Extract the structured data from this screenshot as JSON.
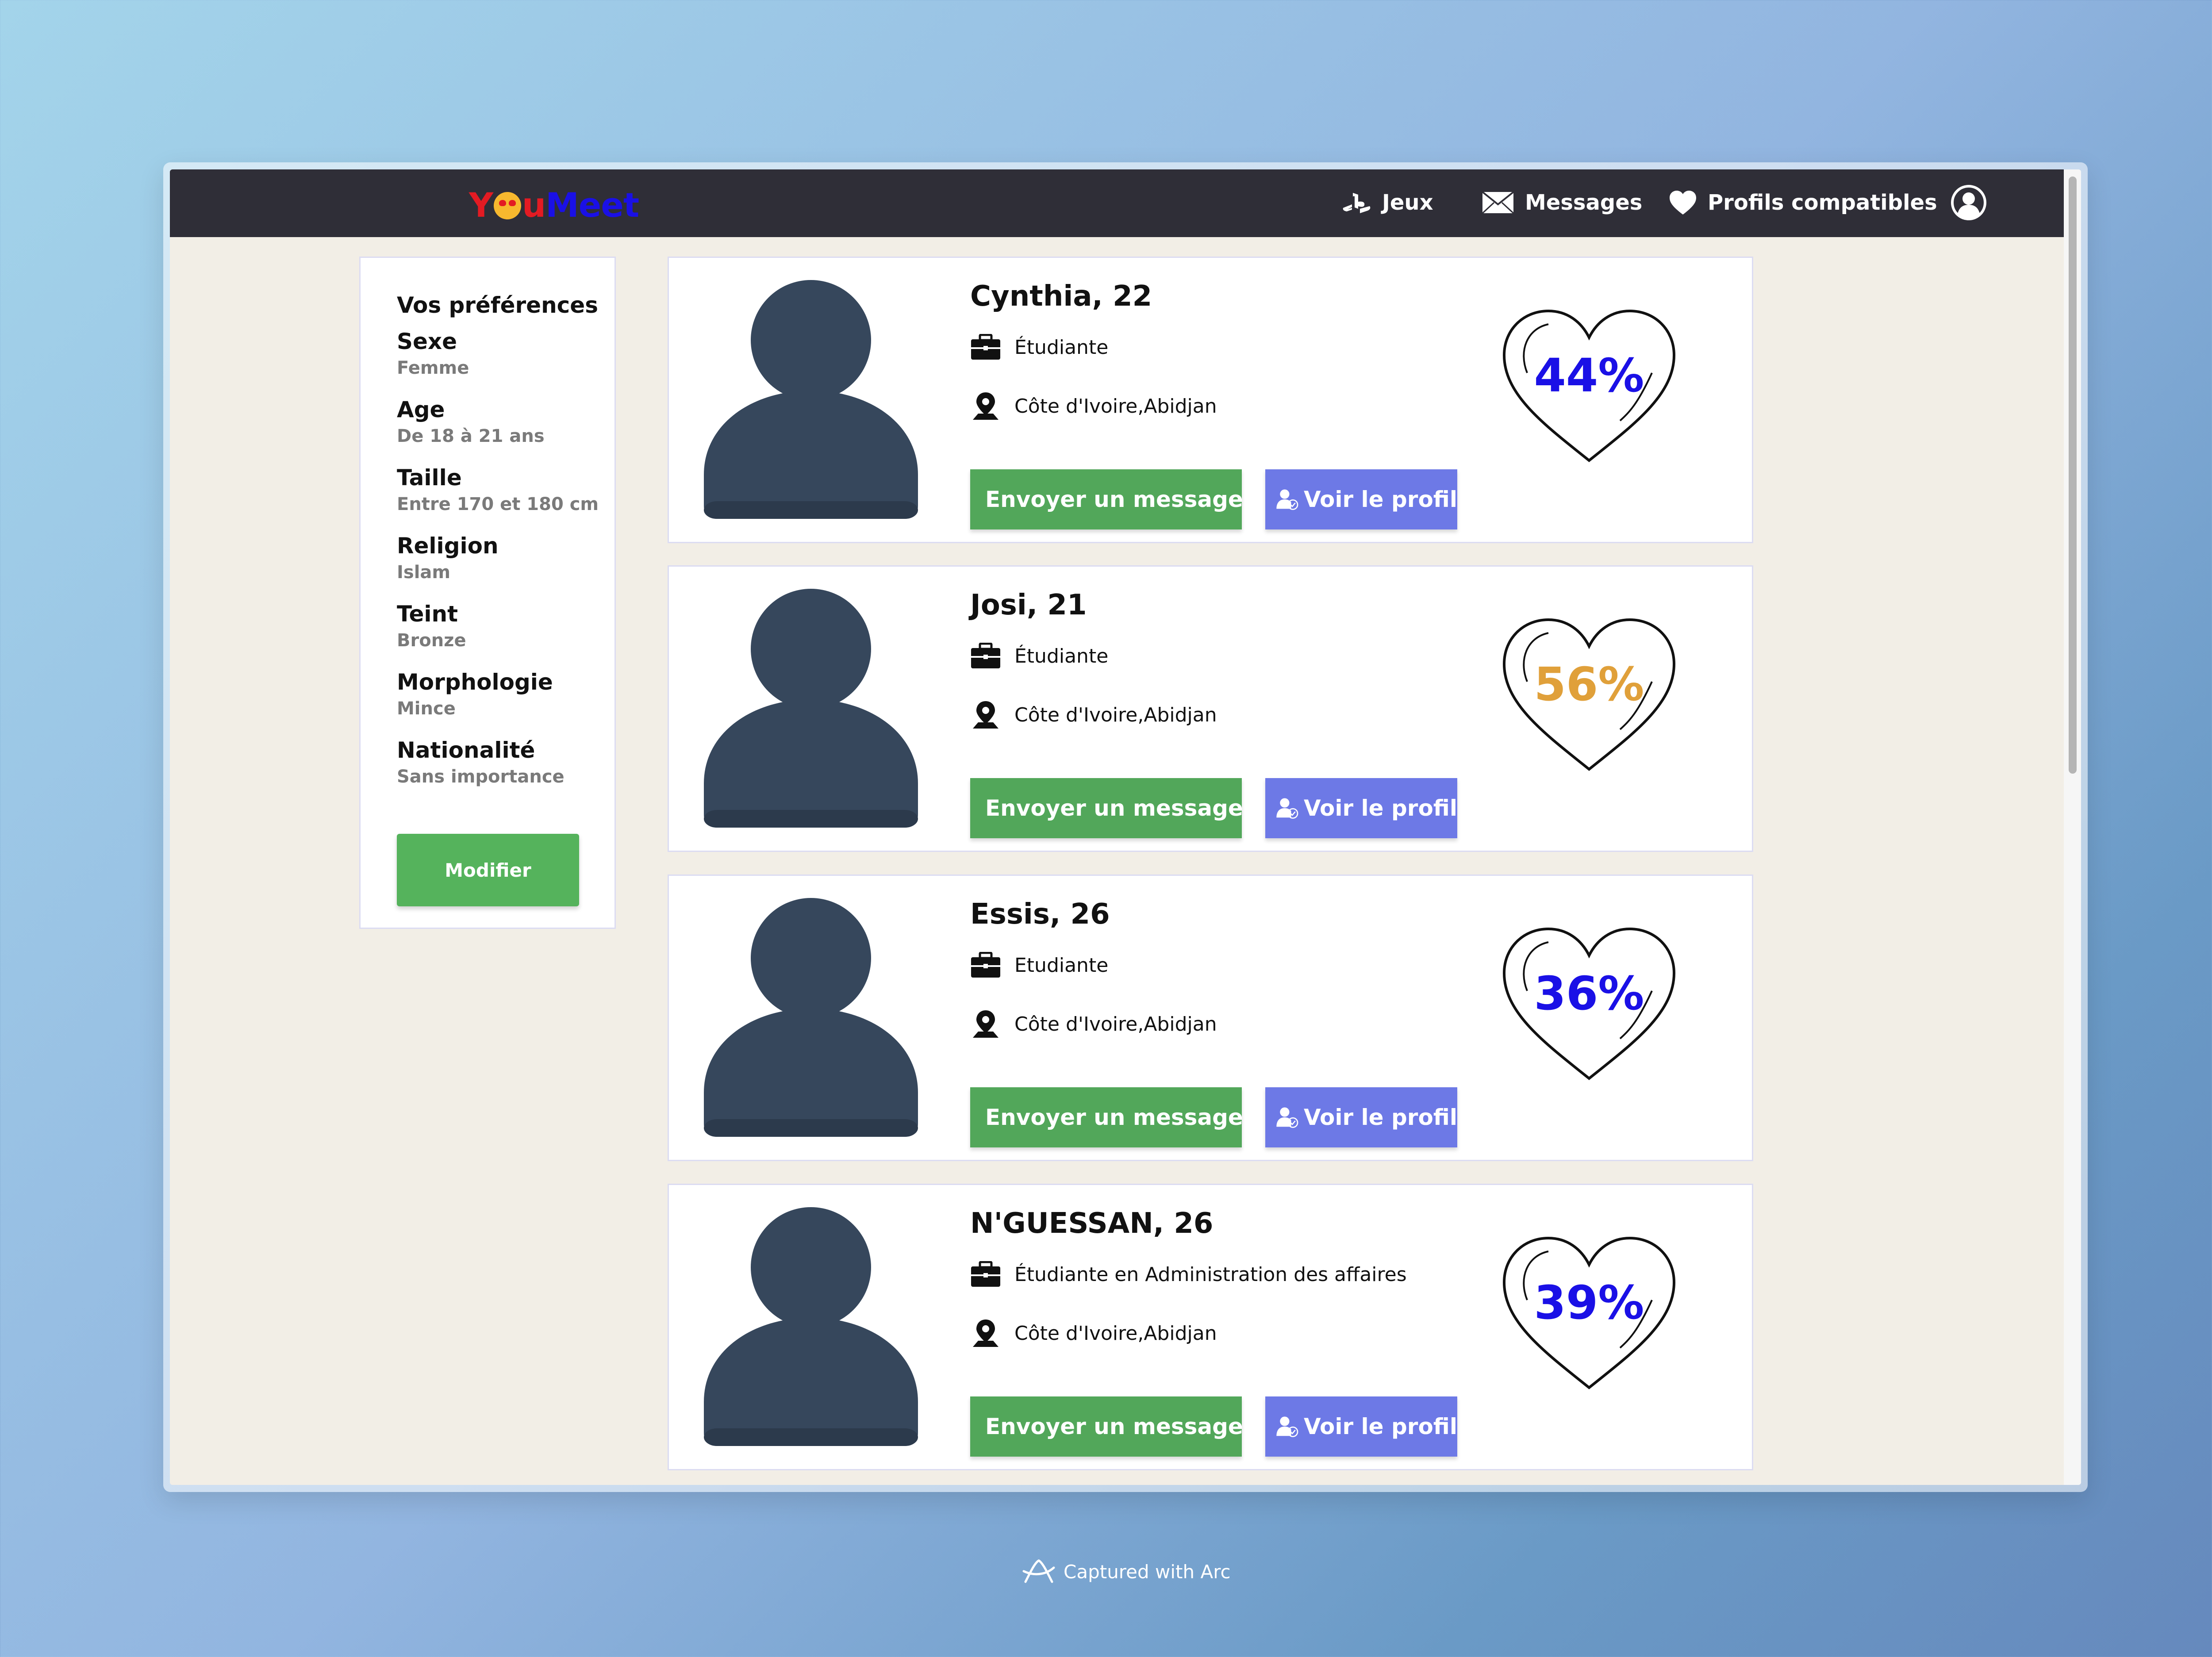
{
  "app": {
    "logo_part1": "Y",
    "logo_part2": "u",
    "logo_part3": "Meet",
    "logo_colors": {
      "red": "#e31b23",
      "blue": "#1a10e6"
    }
  },
  "nav": {
    "games_label": "Jeux",
    "messages_label": "Messages",
    "matches_label": "Profils compatibles",
    "icons": [
      "playstation-icon",
      "envelope-icon",
      "heart-icon",
      "user-circle-icon"
    ]
  },
  "preferences": {
    "title": "Vos préférences",
    "items": [
      {
        "label": "Sexe",
        "value": "Femme"
      },
      {
        "label": "Age",
        "value": "De 18 à 21 ans"
      },
      {
        "label": "Taille",
        "value": "Entre 170 et 180 cm"
      },
      {
        "label": "Religion",
        "value": "Islam"
      },
      {
        "label": "Teint",
        "value": "Bronze"
      },
      {
        "label": "Morphologie",
        "value": "Mince"
      },
      {
        "label": "Nationalité",
        "value": "Sans importance"
      }
    ],
    "edit_button": "Modifier"
  },
  "profiles": [
    {
      "name": "Cynthia, 22",
      "job": "Étudiante",
      "location": "Côte d'Ivoire,Abidjan",
      "compatibility": "44%",
      "compatibility_color": "#1a10e6"
    },
    {
      "name": "Josi, 21",
      "job": "Étudiante",
      "location": "Côte d'Ivoire,Abidjan",
      "compatibility": "56%",
      "compatibility_color": "#e0a03a"
    },
    {
      "name": "Essis, 26",
      "job": "Etudiante",
      "location": "Côte d'Ivoire,Abidjan",
      "compatibility": "36%",
      "compatibility_color": "#1a10e6"
    },
    {
      "name": "N'GUESSAN, 26",
      "job": "Étudiante en Administration des affaires",
      "location": "Côte d'Ivoire,Abidjan",
      "compatibility": "39%",
      "compatibility_color": "#1a10e6"
    }
  ],
  "actions": {
    "message_label": "Envoyer un message",
    "view_profile_label": "Voir le profil"
  },
  "colors": {
    "navbar": "#2f2e37",
    "message_button": "#52a75a",
    "view_button": "#6d79e6",
    "edit_button": "#55b35c",
    "avatar": "#36475c"
  },
  "footer": {
    "captured": "Captured with Arc"
  }
}
